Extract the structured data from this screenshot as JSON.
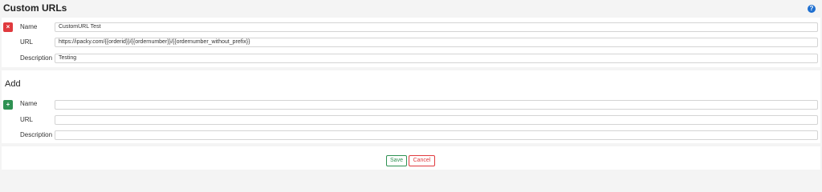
{
  "page": {
    "title": "Custom URLs",
    "help_icon": "question-circle-icon"
  },
  "existing": {
    "remove_icon": "×",
    "fields": {
      "name_label": "Name",
      "name_value": "CustomURL Test",
      "url_label": "URL",
      "url_value": "https://ipacky.com/{{orderid}}/{{ordernumber}}/{{ordernumber_without_prefix}}",
      "description_label": "Description",
      "description_value": "Testing"
    }
  },
  "add": {
    "section_title": "Add",
    "add_icon": "+",
    "fields": {
      "name_label": "Name",
      "name_value": "",
      "url_label": "URL",
      "url_value": "",
      "description_label": "Description",
      "description_value": ""
    }
  },
  "actions": {
    "save_label": "Save",
    "cancel_label": "Cancel"
  },
  "colors": {
    "danger": "#e03a3e",
    "success": "#2e9152",
    "info": "#1e6fd0"
  }
}
